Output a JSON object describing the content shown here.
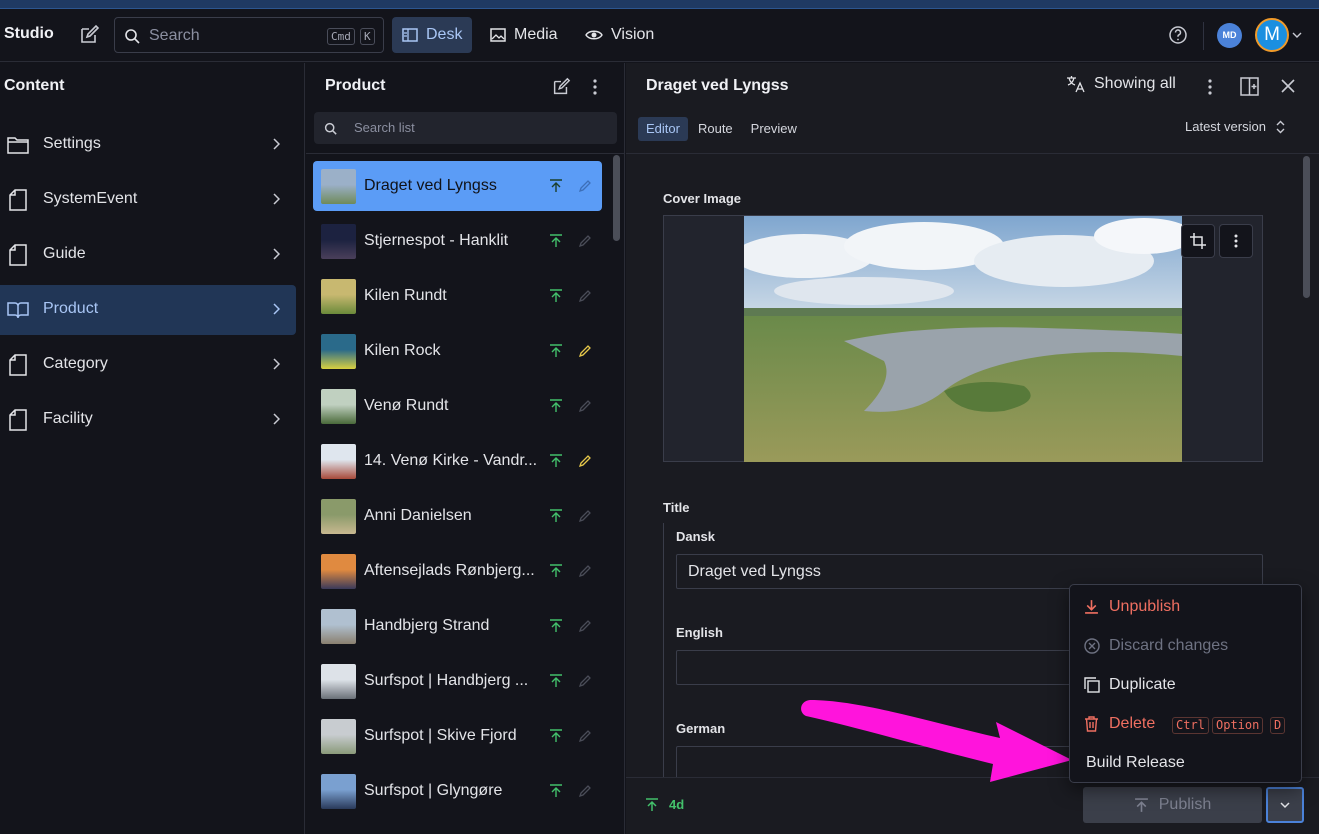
{
  "navbar": {
    "brand": "Studio",
    "search_placeholder": "Search",
    "search_kbd": [
      "Cmd",
      "K"
    ],
    "tabs": [
      {
        "label": "Desk",
        "icon": "desk-icon",
        "active": true
      },
      {
        "label": "Media",
        "icon": "image-icon",
        "active": false
      },
      {
        "label": "Vision",
        "icon": "eye-icon",
        "active": false
      }
    ],
    "user_initials_small": "MD",
    "user_initial_large": "M"
  },
  "content_pane": {
    "title": "Content",
    "items": [
      {
        "label": "Settings",
        "icon": "folder-icon",
        "active": false
      },
      {
        "label": "SystemEvent",
        "icon": "document-icon",
        "active": false
      },
      {
        "label": "Guide",
        "icon": "document-icon",
        "active": false
      },
      {
        "label": "Product",
        "icon": "book-icon",
        "active": true
      },
      {
        "label": "Category",
        "icon": "document-icon",
        "active": false
      },
      {
        "label": "Facility",
        "icon": "document-icon",
        "active": false
      }
    ]
  },
  "list_pane": {
    "title": "Product",
    "search_placeholder": "Search list",
    "items": [
      {
        "title": "Draget ved Lyngss",
        "active": true,
        "edited": false,
        "thumb": [
          "#9bb0c8",
          "#6f8a5a"
        ]
      },
      {
        "title": "Stjernespot - Hanklit",
        "active": false,
        "edited": false,
        "thumb": [
          "#1c2240",
          "#4a3f5a"
        ]
      },
      {
        "title": "Kilen Rundt",
        "active": false,
        "edited": false,
        "thumb": [
          "#c8b870",
          "#6b8a3a"
        ]
      },
      {
        "title": "Kilen Rock",
        "active": false,
        "edited": true,
        "thumb": [
          "#2a6a8a",
          "#d8d040"
        ]
      },
      {
        "title": "Venø Rundt",
        "active": false,
        "edited": false,
        "thumb": [
          "#c0d0c0",
          "#4a6a3a"
        ]
      },
      {
        "title": "14. Venø Kirke - Vandr...",
        "active": false,
        "edited": true,
        "thumb": [
          "#dfe6ee",
          "#a84a3a"
        ]
      },
      {
        "title": "Anni Danielsen",
        "active": false,
        "edited": false,
        "thumb": [
          "#8a9a6a",
          "#c8b890"
        ]
      },
      {
        "title": "Aftensejlads Rønbjerg...",
        "active": false,
        "edited": false,
        "thumb": [
          "#e08a40",
          "#3a3a5a"
        ]
      },
      {
        "title": "Handbjerg Strand",
        "active": false,
        "edited": false,
        "thumb": [
          "#b0c0d0",
          "#8a8070"
        ]
      },
      {
        "title": "Surfspot | Handbjerg ...",
        "active": false,
        "edited": false,
        "thumb": [
          "#dde2e8",
          "#6a7078"
        ]
      },
      {
        "title": "Surfspot | Skive Fjord",
        "active": false,
        "edited": false,
        "thumb": [
          "#c8ccd0",
          "#8a9a7a"
        ]
      },
      {
        "title": "Surfspot | Glyngøre",
        "active": false,
        "edited": false,
        "thumb": [
          "#7aa0d0",
          "#2a3a5a"
        ]
      }
    ]
  },
  "document": {
    "title": "Draget ved Lyngss",
    "showing": "Showing all",
    "tabs": [
      {
        "label": "Editor",
        "active": true
      },
      {
        "label": "Route",
        "active": false
      },
      {
        "label": "Preview",
        "active": false
      }
    ],
    "version": "Latest version",
    "cover_label": "Cover Image",
    "title_label": "Title",
    "fields": [
      {
        "label": "Dansk",
        "value": "Draget ved Lyngss"
      },
      {
        "label": "English",
        "value": ""
      },
      {
        "label": "German",
        "value": ""
      }
    ],
    "footer": {
      "published_age": "4d",
      "publish_label": "Publish"
    }
  },
  "menu": {
    "items": [
      {
        "label": "Unpublish",
        "icon": "unpublish-icon",
        "tone": "danger"
      },
      {
        "label": "Discard changes",
        "icon": "discard-icon",
        "tone": "disabled"
      },
      {
        "label": "Duplicate",
        "icon": "duplicate-icon",
        "tone": "plain"
      },
      {
        "label": "Delete",
        "icon": "trash-icon",
        "tone": "danger",
        "shortcut": [
          "Ctrl",
          "Option",
          "D"
        ]
      },
      {
        "label": "Build Release",
        "icon": "",
        "tone": "plain"
      }
    ]
  },
  "colors": {
    "accent": "#5b9cf6",
    "published_green": "#43c06b",
    "edited_yellow": "#e6c84a",
    "danger": "#ef6f61",
    "annotation_magenta": "#ff14dc"
  }
}
